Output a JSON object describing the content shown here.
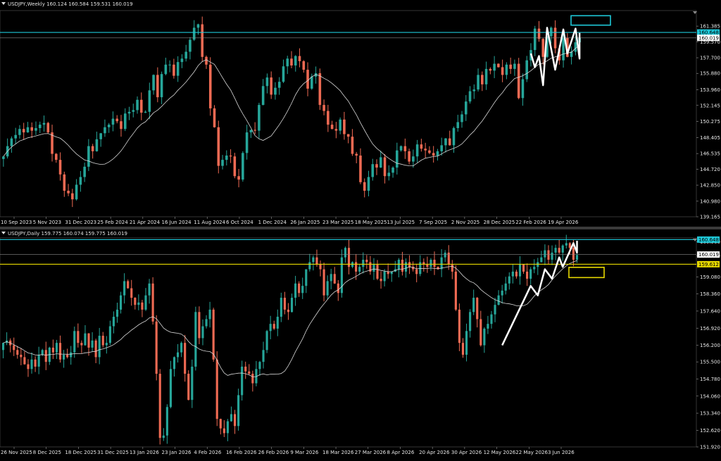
{
  "colors": {
    "background": "#000000",
    "bull": "#26a69a",
    "bear": "#ef6a53",
    "ma": "#d8d8d8",
    "grid": "#ffffff",
    "resistance": "#1ec8d8",
    "support": "#e6d800",
    "pattern": "#ffffff"
  },
  "panes": [
    {
      "id": "weekly",
      "title": "USDJPY,Weekly  160.124 160.584 159.531 160.019",
      "price_min": 139.165,
      "price_max": 163.2,
      "price_ticks": [
        "161.385",
        "159.570",
        "157.700",
        "155.880",
        "153.960",
        "152.145",
        "150.275",
        "148.405",
        "146.535",
        "144.720",
        "142.850",
        "140.980",
        "139.165"
      ],
      "time_labels": [
        "10 Sep 2023",
        "5 Nov 2023",
        "31 Dec 2023",
        "25 Feb 2024",
        "21 Apr 2024",
        "16 Jun 2024",
        "11 Aug 2024",
        "6 Oct 2024",
        "1 Dec 2024",
        "26 Jan 2025",
        "23 Mar 2025",
        "18 May 2025",
        "13 Jul 2025",
        "7 Sep 2025",
        "2 Nov 2025",
        "28 Dec 2025",
        "22 Feb 2026",
        "19 Apr 2026"
      ],
      "tags": [
        {
          "value": "160.648",
          "kind": "resistance"
        },
        {
          "value": "160.019",
          "kind": "current"
        }
      ],
      "series_close": [
        146.2,
        147.4,
        148.3,
        148.7,
        149.4,
        149.0,
        149.6,
        149.2,
        149.5,
        149.9,
        150.1,
        149.0,
        146.5,
        145.8,
        144.1,
        142.2,
        141.9,
        141.2,
        142.9,
        143.8,
        145.0,
        147.4,
        146.8,
        148.2,
        148.9,
        149.6,
        149.9,
        150.6,
        150.3,
        149.4,
        151.2,
        151.4,
        151.6,
        152.8,
        151.3,
        151.4,
        153.9,
        155.7,
        153.1,
        155.8,
        156.9,
        156.9,
        155.6,
        157.2,
        157.6,
        158.4,
        159.8,
        161.2,
        161.6,
        157.8,
        156.9,
        151.8,
        149.6,
        145.1,
        145.8,
        146.3,
        146.2,
        143.9,
        143.5,
        146.6,
        149.0,
        149.3,
        149.2,
        152.2,
        154.4,
        155.4,
        153.4,
        154.2,
        154.9,
        156.7,
        157.6,
        156.8,
        157.9,
        157.3,
        156.3,
        154.1,
        155.5,
        155.9,
        152.2,
        151.5,
        149.9,
        149.4,
        149.2,
        150.5,
        148.8,
        148.5,
        146.5,
        146.3,
        143.2,
        142.2,
        143.8,
        145.3,
        144.9,
        146.1,
        143.9,
        144.3,
        144.9,
        146.9,
        147.4,
        146.8,
        145.6,
        146.2,
        147.6,
        147.1,
        146.9,
        146.6,
        146.3,
        146.8,
        147.5,
        148.3,
        147.5,
        149.5,
        150.2,
        151.1,
        152.6,
        153.8,
        154.0,
        155.7,
        154.6,
        156.4,
        156.2,
        157.0,
        156.6,
        155.7,
        156.9,
        156.4,
        157.0,
        153.0,
        155.2,
        157.4,
        158.6,
        161.1,
        159.9,
        157.8,
        160.2,
        161.2,
        158.8,
        157.4,
        160.0,
        157.8,
        158.4,
        159.5,
        160.0
      ]
    },
    {
      "id": "daily",
      "title": "USDJPY,Daily  159.775 160.074 159.775 160.019",
      "price_min": 151.92,
      "price_max": 160.72,
      "price_ticks": [
        "160.560",
        "159.970",
        "159.080",
        "158.360",
        "157.640",
        "156.920",
        "156.200",
        "155.500",
        "154.780",
        "154.060",
        "153.340",
        "152.620",
        "151.920"
      ],
      "time_labels": [
        "26 Nov 2025",
        "8 Dec 2025",
        "18 Dec 2025",
        "31 Dec 2025",
        "13 Jan 2026",
        "23 Jan 2026",
        "4 Feb 2026",
        "16 Feb 2026",
        "26 Feb 2026",
        "9 Mar 2026",
        "18 Mar 2026",
        "27 Mar 2026",
        "8 Apr 2026",
        "20 Apr 2026",
        "30 Apr 2026",
        "12 May 2026",
        "22 May 2026",
        "3 Jun 2026"
      ],
      "tags": [
        {
          "value": "160.648",
          "kind": "resistance"
        },
        {
          "value": "160.019",
          "kind": "current"
        },
        {
          "value": "159.612",
          "kind": "support"
        }
      ],
      "series_close": [
        156.3,
        156.4,
        156.2,
        156.0,
        155.8,
        155.7,
        155.4,
        155.2,
        155.6,
        155.3,
        155.8,
        156.0,
        155.5,
        156.1,
        155.9,
        156.3,
        155.6,
        155.8,
        155.7,
        155.9,
        156.8,
        156.3,
        156.2,
        156.7,
        156.1,
        156.4,
        155.7,
        156.6,
        156.2,
        156.3,
        157.0,
        157.4,
        157.7,
        158.3,
        158.9,
        158.6,
        158.2,
        157.9,
        158.0,
        157.7,
        158.3,
        158.8,
        157.2,
        155.0,
        152.3,
        152.4,
        153.6,
        155.2,
        155.7,
        155.9,
        156.3,
        155.0,
        153.9,
        155.3,
        157.6,
        156.5,
        157.0,
        157.3,
        157.7,
        155.6,
        153.1,
        152.7,
        152.5,
        153.0,
        153.3,
        152.8,
        154.1,
        155.3,
        155.1,
        155.0,
        154.6,
        155.2,
        155.5,
        156.0,
        156.8,
        157.1,
        156.9,
        157.4,
        158.2,
        157.7,
        157.6,
        158.2,
        158.8,
        158.4,
        158.7,
        159.4,
        159.7,
        159.9,
        159.6,
        159.4,
        158.3,
        158.9,
        159.2,
        158.8,
        158.4,
        159.9,
        160.3,
        159.5,
        159.7,
        159.3,
        159.5,
        159.8,
        159.7,
        159.3,
        159.6,
        159.0,
        158.9,
        159.3,
        159.2,
        159.3,
        159.4,
        159.8,
        159.3,
        159.7,
        159.5,
        159.4,
        159.2,
        159.7,
        159.6,
        159.5,
        159.8,
        159.5,
        159.4,
        159.9,
        160.1,
        159.6,
        159.3,
        157.7,
        156.3,
        155.8,
        156.8,
        157.6,
        158.2,
        157.3,
        156.2,
        156.9,
        157.1,
        157.5,
        157.9,
        158.3,
        158.5,
        158.8,
        159.1,
        159.3,
        159.1,
        159.6,
        159.3,
        159.0,
        159.4,
        159.5,
        159.7,
        159.9,
        160.2,
        159.8,
        160.1,
        160.3,
        160.1,
        160.4,
        160.5,
        160.3,
        159.8,
        160.0
      ]
    }
  ]
}
